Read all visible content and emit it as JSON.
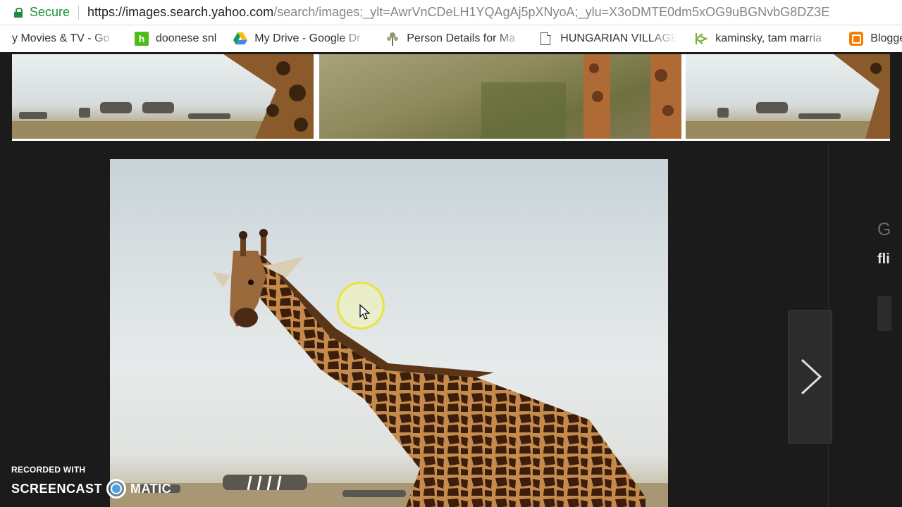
{
  "addressbar": {
    "secure_label": "Secure",
    "url_host": "https://images.search.yahoo.com",
    "url_rest": "/search/images;_ylt=AwrVnCDeLH1YQAgAj5pXNyoA;_ylu=X3oDMTE0dm5xOG9uBGNvbG8DZ3E"
  },
  "bookmarks": [
    {
      "label": "y Movies & TV - Go",
      "icon": "none"
    },
    {
      "label": "doonese snl",
      "icon": "houzz-icon"
    },
    {
      "label": "My Drive - Google Dr",
      "icon": "google-drive-icon"
    },
    {
      "label": "Person Details for Ma",
      "icon": "family-tree-icon"
    },
    {
      "label": "HUNGARIAN VILLAGE",
      "icon": "page-icon"
    },
    {
      "label": "kaminsky, tam marria",
      "icon": "ancestry-icon"
    },
    {
      "label": "Blogge",
      "icon": "blogger-icon"
    }
  ],
  "side_panel": {
    "initial": "G",
    "label": "fli"
  },
  "watermark": {
    "line1": "RECORDED WITH",
    "brand_left": "SCREENCAST",
    "brand_right": "MATIC"
  }
}
